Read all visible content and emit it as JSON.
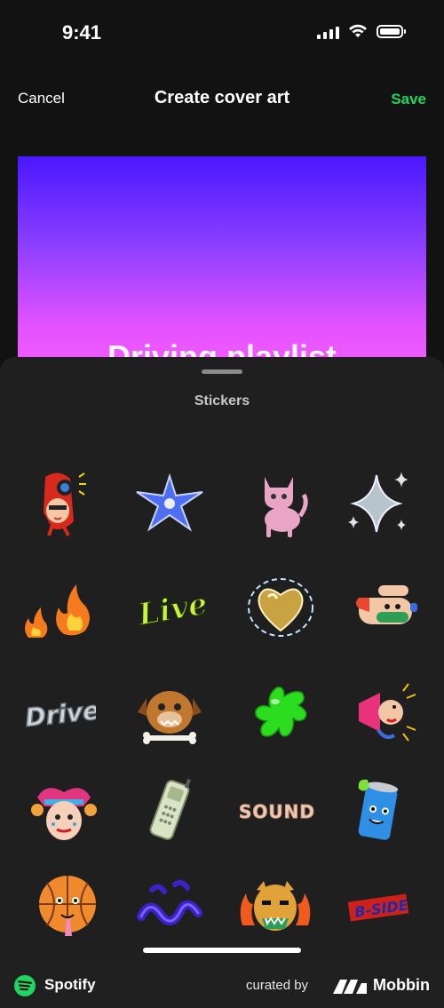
{
  "status_bar": {
    "time": "9:41"
  },
  "nav": {
    "cancel_label": "Cancel",
    "title": "Create cover art",
    "save_label": "Save"
  },
  "cover": {
    "title": "Driving playlist"
  },
  "sheet": {
    "title": "Stickers"
  },
  "stickers": [
    "face-sticker-icon",
    "blue-starfish-icon",
    "pink-cat-icon",
    "sparkle-stars-icon",
    "flames-icon",
    "live-text-icon",
    "gold-heart-icon",
    "hand-sticker-icon",
    "drive-text-icon",
    "dog-with-bone-icon",
    "green-splat-icon",
    "megaphone-sticker-icon",
    "jester-face-icon",
    "cell-phone-icon",
    "sounds-text-icon",
    "soda-can-icon",
    "basketball-icon",
    "blue-squiggle-icon",
    "tiger-face-icon",
    "b-side-text-icon"
  ],
  "footer": {
    "app_name": "Spotify",
    "curated_by": "curated by",
    "brand": "Mobbin"
  },
  "colors": {
    "accent": "#1ed760",
    "background": "#121212",
    "sheet": "#1f1f1f"
  }
}
